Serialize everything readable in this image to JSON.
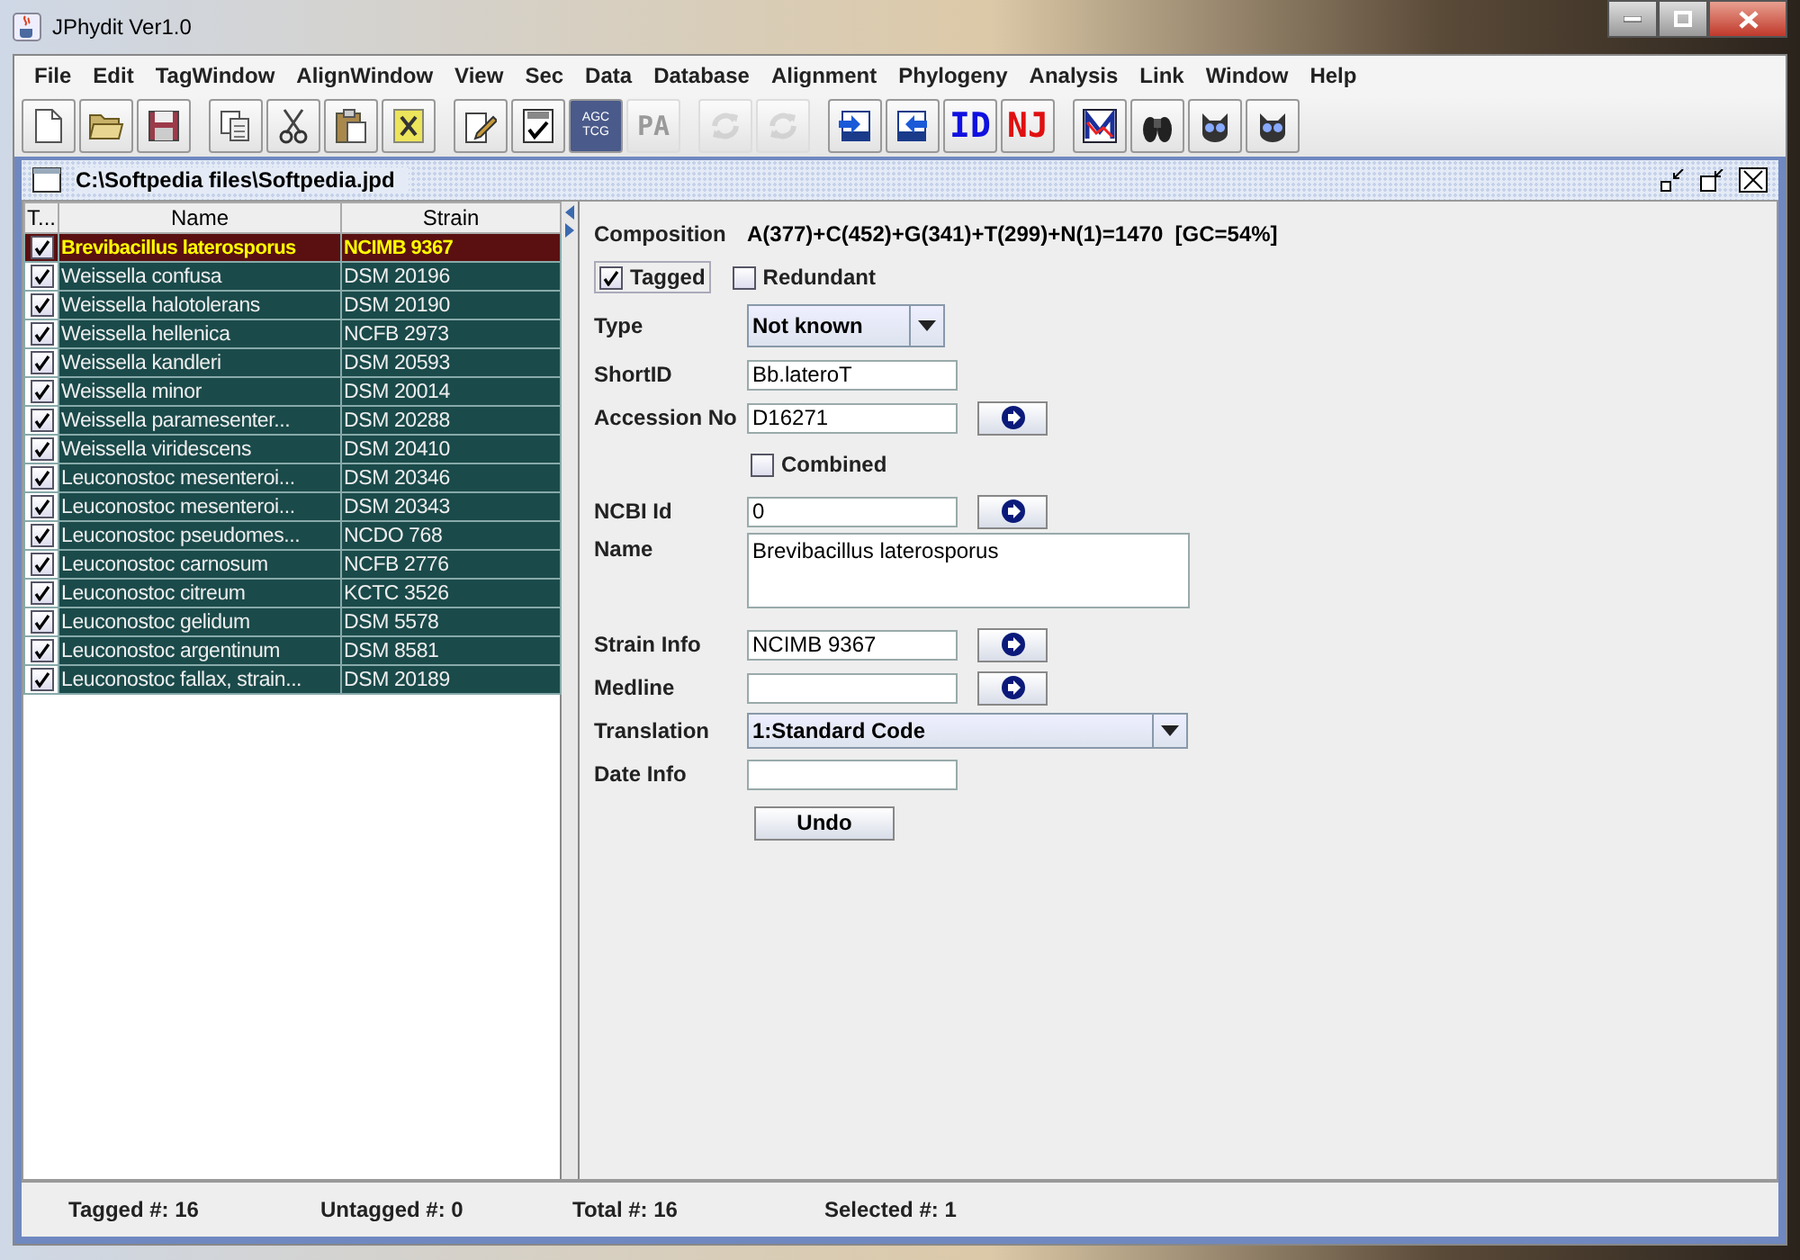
{
  "window": {
    "title": "JPhydit Ver1.0"
  },
  "menu": [
    "File",
    "Edit",
    "TagWindow",
    "AlignWindow",
    "View",
    "Sec",
    "Data",
    "Database",
    "Alignment",
    "Phylogeny",
    "Analysis",
    "Link",
    "Window",
    "Help"
  ],
  "toolbar": [
    [
      {
        "kind": "icon",
        "disabled": false
      },
      {
        "kind": "icon",
        "disabled": false
      },
      {
        "kind": "icon",
        "disabled": false
      }
    ],
    [
      {
        "kind": "icon",
        "disabled": false
      },
      {
        "kind": "icon",
        "disabled": false
      },
      {
        "kind": "icon",
        "disabled": false
      },
      {
        "kind": "icon",
        "disabled": false
      }
    ],
    [
      {
        "kind": "icon",
        "disabled": false
      },
      {
        "kind": "icon",
        "disabled": false
      },
      {
        "kind": "bases",
        "lines": [
          "AGC",
          "TCG"
        ],
        "disabled": false
      },
      {
        "kind": "text",
        "label": "PA",
        "disabled": true
      }
    ],
    [
      {
        "kind": "icon",
        "disabled": true
      },
      {
        "kind": "icon",
        "disabled": true
      }
    ],
    [
      {
        "kind": "icon",
        "disabled": false
      },
      {
        "kind": "icon",
        "disabled": false
      },
      {
        "kind": "text",
        "label": "ID",
        "disabled": false
      },
      {
        "kind": "text",
        "label": "NJ",
        "disabled": false
      }
    ],
    [
      {
        "kind": "icon",
        "disabled": false
      },
      {
        "kind": "icon",
        "disabled": false
      },
      {
        "kind": "icon",
        "disabled": false
      },
      {
        "kind": "icon",
        "disabled": false
      }
    ]
  ],
  "frame": {
    "title": "C:\\Softpedia files\\Softpedia.jpd"
  },
  "table": {
    "columns": [
      "T...",
      "Name",
      "Strain"
    ],
    "rows": [
      {
        "tagged": true,
        "name": "Brevibacillus laterosporus",
        "strain": "NCIMB 9367",
        "selected": true
      },
      {
        "tagged": true,
        "name": "Weissella confusa",
        "strain": "DSM 20196",
        "selected": false
      },
      {
        "tagged": true,
        "name": "Weissella halotolerans",
        "strain": "DSM 20190",
        "selected": false
      },
      {
        "tagged": true,
        "name": "Weissella hellenica",
        "strain": "NCFB 2973",
        "selected": false
      },
      {
        "tagged": true,
        "name": "Weissella kandleri",
        "strain": "DSM 20593",
        "selected": false
      },
      {
        "tagged": true,
        "name": "Weissella minor",
        "strain": "DSM 20014",
        "selected": false
      },
      {
        "tagged": true,
        "name": "Weissella paramesenter...",
        "strain": "DSM 20288",
        "selected": false
      },
      {
        "tagged": true,
        "name": "Weissella viridescens",
        "strain": "DSM 20410",
        "selected": false
      },
      {
        "tagged": true,
        "name": "Leuconostoc mesenteroi...",
        "strain": "DSM 20346",
        "selected": false
      },
      {
        "tagged": true,
        "name": "Leuconostoc mesenteroi...",
        "strain": "DSM 20343",
        "selected": false
      },
      {
        "tagged": true,
        "name": "Leuconostoc pseudomes...",
        "strain": "NCDO 768",
        "selected": false
      },
      {
        "tagged": true,
        "name": "Leuconostoc carnosum",
        "strain": "NCFB 2776",
        "selected": false
      },
      {
        "tagged": true,
        "name": "Leuconostoc citreum",
        "strain": "KCTC 3526",
        "selected": false
      },
      {
        "tagged": true,
        "name": "Leuconostoc gelidum",
        "strain": "DSM 5578",
        "selected": false
      },
      {
        "tagged": true,
        "name": "Leuconostoc argentinum",
        "strain": "DSM 8581",
        "selected": false
      },
      {
        "tagged": true,
        "name": "Leuconostoc fallax, strain...",
        "strain": "DSM 20189",
        "selected": false
      }
    ]
  },
  "form": {
    "composition_label": "Composition",
    "composition": "A(377)+C(452)+G(341)+T(299)+N(1)=1470  [GC=54%]",
    "tagged": {
      "label": "Tagged",
      "checked": true
    },
    "redundant": {
      "label": "Redundant",
      "checked": false
    },
    "type": {
      "label": "Type",
      "value": "Not known"
    },
    "short_id": {
      "label": "ShortID",
      "value": "Bb.lateroT"
    },
    "accession": {
      "label": "Accession No",
      "value": "D16271"
    },
    "combined": {
      "label": "Combined",
      "checked": false
    },
    "ncbi_id": {
      "label": "NCBI Id",
      "value": "0"
    },
    "name": {
      "label": "Name",
      "value": "Brevibacillus laterosporus"
    },
    "strain_info": {
      "label": "Strain Info",
      "value": "NCIMB 9367"
    },
    "medline": {
      "label": "Medline"
    },
    "translation": {
      "label": "Translation",
      "value": "1:Standard Code"
    },
    "date_info": {
      "label": "Date Info"
    },
    "undo": "Undo"
  },
  "status_bar": [
    "Tagged #: 16",
    "Untagged #: 0",
    "Total #: 16",
    "Selected #: 1"
  ]
}
